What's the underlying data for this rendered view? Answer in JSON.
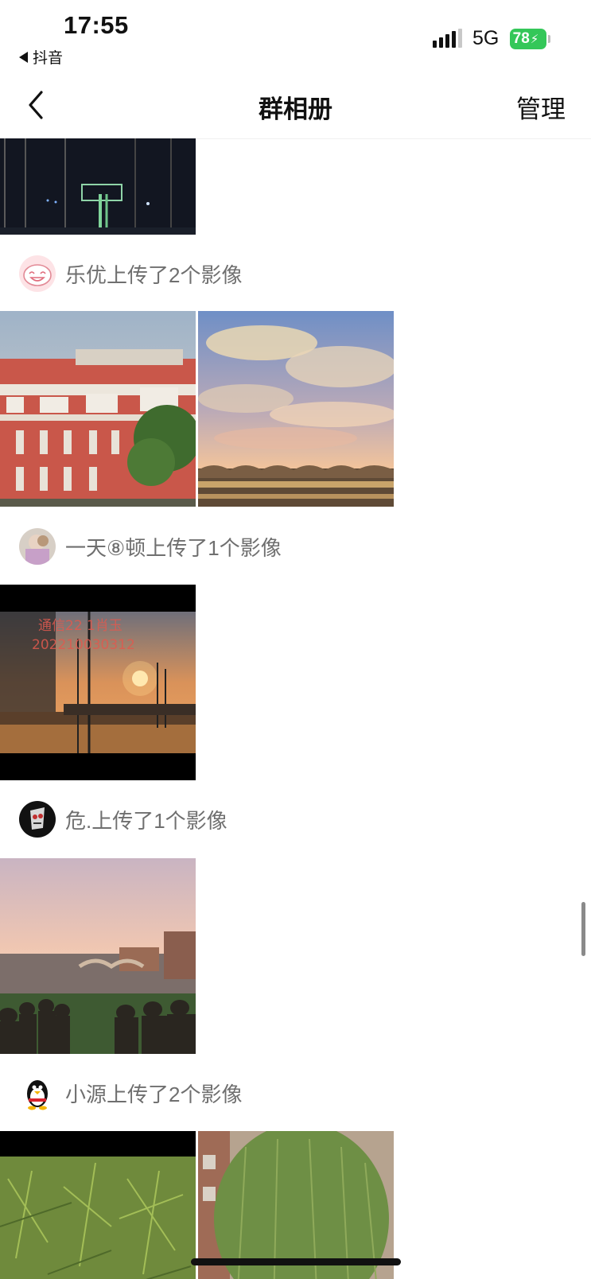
{
  "status_bar": {
    "time": "17:55",
    "back_app": "抖音",
    "network": "5G",
    "battery": "78"
  },
  "nav": {
    "title": "群相册",
    "manage_label": "管理"
  },
  "groups": [
    {
      "title": "乐优上传了2个影像",
      "avatar_icon": "smiley-avatar-icon"
    },
    {
      "title": "一天⑧顿上传了1个影像",
      "avatar_icon": "photo-avatar-icon"
    },
    {
      "title": "危.上传了1个影像",
      "avatar_icon": "skull-avatar-icon"
    },
    {
      "title": "小源上传了2个影像",
      "avatar_icon": "penguin-avatar-icon"
    }
  ],
  "photo_watermark": {
    "line1": "通信22 1肖玉",
    "line2": "202210030312"
  },
  "colors": {
    "background": "#ffffff",
    "caption": "#6f6f6f",
    "battery": "#34c759"
  }
}
